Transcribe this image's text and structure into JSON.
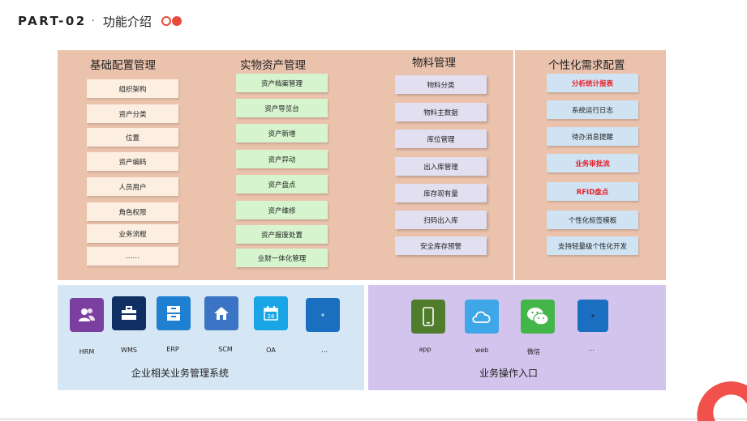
{
  "header": {
    "part": "PART-02",
    "separator": "·",
    "subtitle": "功能介绍"
  },
  "columns": [
    {
      "title": "基础配置管理",
      "items": [
        "组织架构",
        "资产分类",
        "位置",
        "资产编码",
        "人员用户",
        "角色权限",
        "业务流程",
        "……"
      ]
    },
    {
      "title": "实物资产管理",
      "items": [
        "资产档案管理",
        "资产导览台",
        "资产新增",
        "资产异动",
        "资产盘点",
        "资产维修",
        "资产报废处置",
        "业财一体化管理"
      ]
    },
    {
      "title": "物料管理",
      "items": [
        "物料分类",
        "物料主数据",
        "库位管理",
        "出入库管理",
        "库存现有量",
        "扫码出入库",
        "安全库存预警"
      ]
    },
    {
      "title": "个性化需求配置",
      "items": [
        "分析统计报表",
        "系统运行日志",
        "待办消息提醒",
        "业务审批流",
        "RFID盘点",
        "个性化标签模板",
        "支持轻量级个性化开发"
      ]
    }
  ],
  "enterprise": {
    "caption": "企业相关业务管理系统",
    "apps": [
      {
        "label": "HRM",
        "icon": "users-icon",
        "color": "#7b3fa0"
      },
      {
        "label": "WMS",
        "icon": "briefcase-icon",
        "color": "#0f2f63"
      },
      {
        "label": "ERP",
        "icon": "archive-icon",
        "color": "#1f7fd0"
      },
      {
        "label": "SCM",
        "icon": "home-icon",
        "color": "#3b74c4"
      },
      {
        "label": "OA",
        "icon": "calendar-icon",
        "color": "#1aa6e6"
      },
      {
        "label": "...",
        "icon": "more-icon",
        "color": "#1a6fc0"
      }
    ]
  },
  "entry": {
    "caption": "业务操作入口",
    "apps": [
      {
        "label": "app",
        "icon": "phone-icon",
        "color": "#4f7d2c"
      },
      {
        "label": "web",
        "icon": "cloud-icon",
        "color": "#3fa6e8"
      },
      {
        "label": "微信",
        "icon": "wechat-icon",
        "color": "#44b549"
      },
      {
        "label": "...",
        "icon": "more-icon",
        "color": "#1a6fc0"
      }
    ]
  },
  "calendar_day": "28",
  "colors": {
    "accent": "#e74b3c",
    "highlight_text": "#e8202a"
  }
}
